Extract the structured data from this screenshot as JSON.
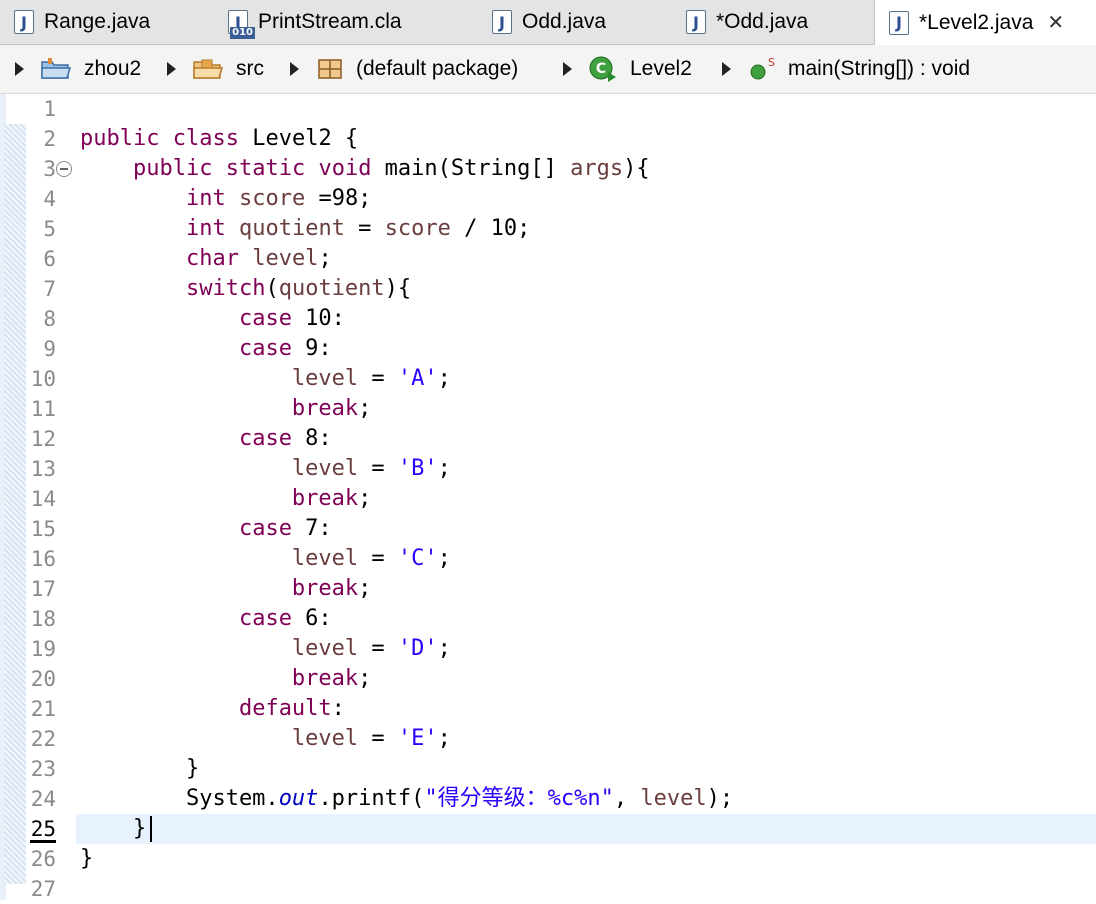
{
  "tabs": [
    {
      "label": "Range.java"
    },
    {
      "label": "PrintStream.cla"
    },
    {
      "label": "Odd.java"
    },
    {
      "label": "*Odd.java"
    },
    {
      "label": "*Level2.java"
    }
  ],
  "breadcrumb": [
    {
      "label": "zhou2",
      "icon": "project-icon"
    },
    {
      "label": "src",
      "icon": "source-folder-icon"
    },
    {
      "label": "(default package)",
      "icon": "package-icon"
    },
    {
      "label": "Level2",
      "icon": "class-icon"
    },
    {
      "label": "main(String[]) : void",
      "icon": "method-icon"
    }
  ],
  "editor": {
    "line_numbers": [
      "1",
      "2",
      "3",
      "4",
      "5",
      "6",
      "7",
      "8",
      "9",
      "10",
      "11",
      "12",
      "13",
      "14",
      "15",
      "16",
      "17",
      "18",
      "19",
      "20",
      "21",
      "22",
      "23",
      "24",
      "25",
      "26",
      "27"
    ],
    "current_line": "25",
    "lines": [
      [],
      [
        {
          "t": "public",
          "c": "kw"
        },
        {
          "t": " "
        },
        {
          "t": "class",
          "c": "kw"
        },
        {
          "t": " Level2 {"
        }
      ],
      [
        {
          "t": "    "
        },
        {
          "t": "public",
          "c": "kw"
        },
        {
          "t": " "
        },
        {
          "t": "static",
          "c": "kw"
        },
        {
          "t": " "
        },
        {
          "t": "void",
          "c": "kw"
        },
        {
          "t": " main(String[] "
        },
        {
          "t": "args",
          "c": "var"
        },
        {
          "t": "){"
        }
      ],
      [
        {
          "t": "        "
        },
        {
          "t": "int",
          "c": "kw"
        },
        {
          "t": " "
        },
        {
          "t": "score",
          "c": "var"
        },
        {
          "t": " =98;"
        }
      ],
      [
        {
          "t": "        "
        },
        {
          "t": "int",
          "c": "kw"
        },
        {
          "t": " "
        },
        {
          "t": "quotient",
          "c": "var"
        },
        {
          "t": " = "
        },
        {
          "t": "score",
          "c": "var"
        },
        {
          "t": " / 10;"
        }
      ],
      [
        {
          "t": "        "
        },
        {
          "t": "char",
          "c": "kw"
        },
        {
          "t": " "
        },
        {
          "t": "level",
          "c": "var"
        },
        {
          "t": ";"
        }
      ],
      [
        {
          "t": "        "
        },
        {
          "t": "switch",
          "c": "kw"
        },
        {
          "t": "("
        },
        {
          "t": "quotient",
          "c": "var"
        },
        {
          "t": "){"
        }
      ],
      [
        {
          "t": "            "
        },
        {
          "t": "case",
          "c": "kw"
        },
        {
          "t": " 10:"
        }
      ],
      [
        {
          "t": "            "
        },
        {
          "t": "case",
          "c": "kw"
        },
        {
          "t": " 9:"
        }
      ],
      [
        {
          "t": "                "
        },
        {
          "t": "level",
          "c": "var"
        },
        {
          "t": " = "
        },
        {
          "t": "'A'",
          "c": "str"
        },
        {
          "t": ";"
        }
      ],
      [
        {
          "t": "                "
        },
        {
          "t": "break",
          "c": "kw"
        },
        {
          "t": ";"
        }
      ],
      [
        {
          "t": "            "
        },
        {
          "t": "case",
          "c": "kw"
        },
        {
          "t": " 8:"
        }
      ],
      [
        {
          "t": "                "
        },
        {
          "t": "level",
          "c": "var"
        },
        {
          "t": " = "
        },
        {
          "t": "'B'",
          "c": "str"
        },
        {
          "t": ";"
        }
      ],
      [
        {
          "t": "                "
        },
        {
          "t": "break",
          "c": "kw"
        },
        {
          "t": ";"
        }
      ],
      [
        {
          "t": "            "
        },
        {
          "t": "case",
          "c": "kw"
        },
        {
          "t": " 7:"
        }
      ],
      [
        {
          "t": "                "
        },
        {
          "t": "level",
          "c": "var"
        },
        {
          "t": " = "
        },
        {
          "t": "'C'",
          "c": "str"
        },
        {
          "t": ";"
        }
      ],
      [
        {
          "t": "                "
        },
        {
          "t": "break",
          "c": "kw"
        },
        {
          "t": ";"
        }
      ],
      [
        {
          "t": "            "
        },
        {
          "t": "case",
          "c": "kw"
        },
        {
          "t": " 6:"
        }
      ],
      [
        {
          "t": "                "
        },
        {
          "t": "level",
          "c": "var"
        },
        {
          "t": " = "
        },
        {
          "t": "'D'",
          "c": "str"
        },
        {
          "t": ";"
        }
      ],
      [
        {
          "t": "                "
        },
        {
          "t": "break",
          "c": "kw"
        },
        {
          "t": ";"
        }
      ],
      [
        {
          "t": "            "
        },
        {
          "t": "default",
          "c": "kw"
        },
        {
          "t": ":"
        }
      ],
      [
        {
          "t": "                "
        },
        {
          "t": "level",
          "c": "var"
        },
        {
          "t": " = "
        },
        {
          "t": "'E'",
          "c": "str"
        },
        {
          "t": ";"
        }
      ],
      [
        {
          "t": "        }"
        }
      ],
      [
        {
          "t": "        System."
        },
        {
          "t": "out",
          "c": "fld"
        },
        {
          "t": ".printf("
        },
        {
          "t": "\"得分等级：%c%n\"",
          "c": "str"
        },
        {
          "t": ", "
        },
        {
          "t": "level",
          "c": "var"
        },
        {
          "t": ");"
        }
      ],
      [
        {
          "t": "    }"
        }
      ],
      [
        {
          "t": "}"
        }
      ],
      []
    ]
  },
  "colors": {
    "keyword": "#7f0055",
    "variable": "#6a3e3e",
    "string": "#2a00ff",
    "static_field": "#0000c0",
    "current_line_bg": "#e8f2fe"
  }
}
